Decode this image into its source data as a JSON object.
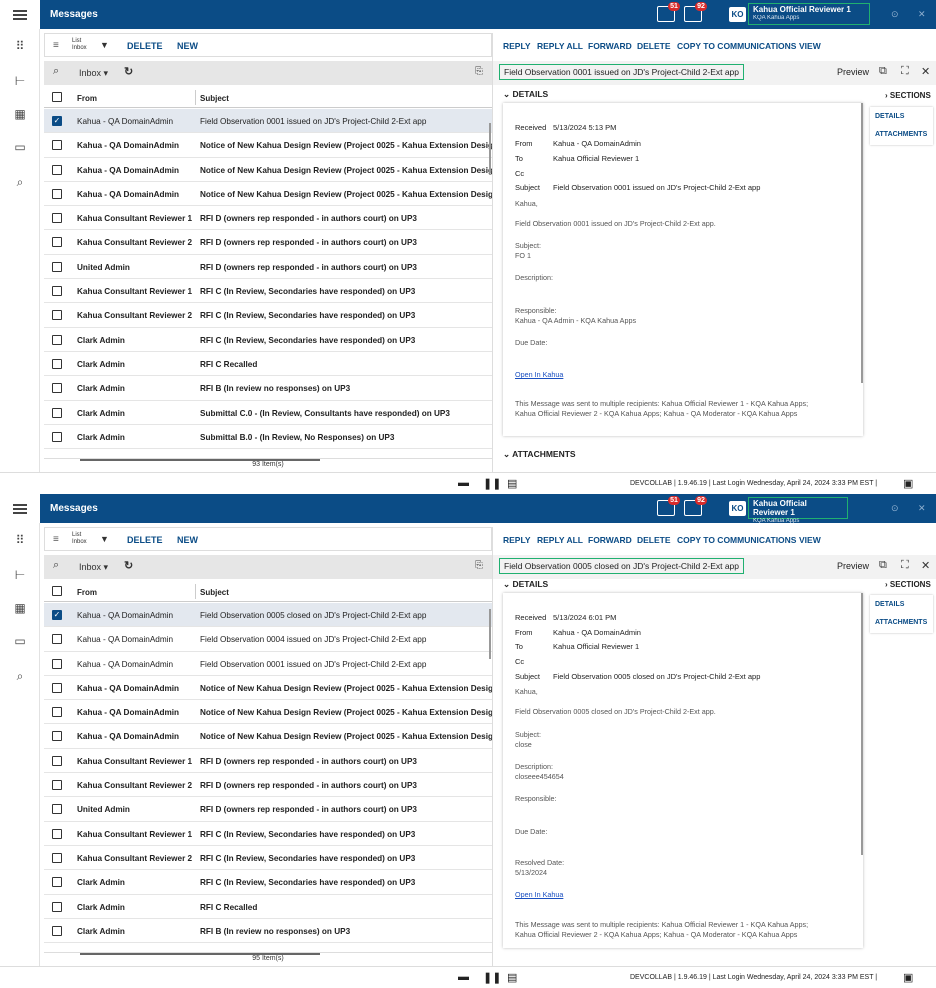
{
  "app": {
    "title": "Messages"
  },
  "header": {
    "ticket_badge": "51",
    "mail_badge": "92",
    "user_initials": "KO",
    "user_name": "Kahua Official Reviewer 1",
    "user_sub": "KQA Kahua Apps"
  },
  "list_toolbar": {
    "view_line1": "List",
    "view_line2": "Inbox",
    "delete": "DELETE",
    "new": "NEW"
  },
  "filter": {
    "folder": "Inbox"
  },
  "columns": {
    "from": "From",
    "subject": "Subject"
  },
  "reading_toolbar": {
    "reply": "REPLY",
    "reply_all": "REPLY ALL",
    "forward": "FORWARD",
    "delete": "DELETE",
    "copy": "COPY TO COMMUNICATIONS",
    "view": "VIEW"
  },
  "labels": {
    "preview": "Preview",
    "sections": "SECTIONS",
    "details": "DETAILS",
    "attachments": "ATTACHMENTS",
    "details_tab": "DETAILS",
    "attachments_tab": "ATTACHMENTS",
    "received": "Received",
    "from": "From",
    "to": "To",
    "cc": "Cc",
    "subject": "Subject",
    "subject_lbl": "Subject:",
    "description_lbl": "Description:",
    "responsible_lbl": "Responsible:",
    "due_lbl": "Due Date:",
    "resolved_lbl": "Resolved Date:",
    "open": "Open In Kahua"
  },
  "status": {
    "text": "DEVCOLLAB  |  1.9.46.19  |  Last Login Wednesday, April 24, 2024 3:33 PM EST  |"
  },
  "p1": {
    "count": "93 Item(s)",
    "rows": [
      {
        "from": "Kahua - QA DomainAdmin",
        "subject": "Field Observation  0001 issued on JD's Project-Child 2-Ext app"
      },
      {
        "from": "Kahua - QA DomainAdmin",
        "subject": "Notice of New Kahua Design Review (Project 0025 - Kahua Extension Design)"
      },
      {
        "from": "Kahua - QA DomainAdmin",
        "subject": "Notice of New Kahua Design Review (Project 0025 - Kahua Extension Design)"
      },
      {
        "from": "Kahua - QA DomainAdmin",
        "subject": "Notice of New Kahua Design Review (Project 0025 - Kahua Extension Design)"
      },
      {
        "from": "Kahua Consultant Reviewer 1",
        "subject": "RFI D (owners rep responded - in authors court) on UP3"
      },
      {
        "from": "Kahua Consultant Reviewer 2",
        "subject": "RFI D (owners rep responded - in authors court) on UP3"
      },
      {
        "from": "United Admin",
        "subject": "RFI D (owners rep responded - in authors court) on UP3"
      },
      {
        "from": "Kahua Consultant Reviewer 1",
        "subject": "RFI C (In Review, Secondaries have responded) on UP3"
      },
      {
        "from": "Kahua Consultant Reviewer 2",
        "subject": "RFI C (In Review, Secondaries have responded) on UP3"
      },
      {
        "from": "Clark Admin",
        "subject": "RFI C (In Review, Secondaries have responded) on UP3"
      },
      {
        "from": "Clark Admin",
        "subject": "RFI C Recalled"
      },
      {
        "from": "Clark Admin",
        "subject": "RFI B (In review no responses) on UP3"
      },
      {
        "from": "Clark Admin",
        "subject": "Submittal C.0 - (In Review, Consultants have responded) on UP3"
      },
      {
        "from": "Clark Admin",
        "subject": "Submittal B.0 - (In Review, No Responses) on UP3"
      }
    ],
    "msg": {
      "subject": "Field Observation  0001 issued on JD's Project-Child 2-Ext app",
      "received": "5/13/2024 5:13 PM",
      "from": "Kahua - QA DomainAdmin",
      "to": "Kahua Official Reviewer 1",
      "greeting": "Kahua,",
      "intro": "Field Observation 0001 issued on JD's Project-Child 2-Ext app.",
      "subject_val": "FO 1",
      "responsible_val": "Kahua - QA Admin - KQA Kahua Apps",
      "recip1": "This Message was sent to multiple recipients: Kahua Official Reviewer 1 - KQA Kahua Apps;",
      "recip2": "Kahua Official Reviewer 2 - KQA Kahua Apps; Kahua - QA Moderator - KQA Kahua Apps"
    }
  },
  "p2": {
    "count": "95 Item(s)",
    "rows": [
      {
        "from": "Kahua - QA DomainAdmin",
        "subject": "Field Observation  0005 closed on JD's Project-Child 2-Ext app"
      },
      {
        "from": "Kahua - QA DomainAdmin",
        "subject": "Field Observation  0004 issued on JD's Project-Child 2-Ext app"
      },
      {
        "from": "Kahua - QA DomainAdmin",
        "subject": "Field Observation  0001 issued on JD's Project-Child 2-Ext app"
      },
      {
        "from": "Kahua - QA DomainAdmin",
        "subject": "Notice of New Kahua Design Review (Project 0025 - Kahua Extension Design)"
      },
      {
        "from": "Kahua - QA DomainAdmin",
        "subject": "Notice of New Kahua Design Review (Project 0025 - Kahua Extension Design)"
      },
      {
        "from": "Kahua - QA DomainAdmin",
        "subject": "Notice of New Kahua Design Review (Project 0025 - Kahua Extension Design)"
      },
      {
        "from": "Kahua Consultant Reviewer 1",
        "subject": "RFI D (owners rep responded - in authors court) on UP3"
      },
      {
        "from": "Kahua Consultant Reviewer 2",
        "subject": "RFI D (owners rep responded - in authors court) on UP3"
      },
      {
        "from": "United Admin",
        "subject": "RFI D (owners rep responded - in authors court) on UP3"
      },
      {
        "from": "Kahua Consultant Reviewer 1",
        "subject": "RFI C (In Review, Secondaries have responded) on UP3"
      },
      {
        "from": "Kahua Consultant Reviewer 2",
        "subject": "RFI C (In Review, Secondaries have responded) on UP3"
      },
      {
        "from": "Clark Admin",
        "subject": "RFI C (In Review, Secondaries have responded) on UP3"
      },
      {
        "from": "Clark Admin",
        "subject": "RFI C Recalled"
      },
      {
        "from": "Clark Admin",
        "subject": "RFI B (In review no responses) on UP3"
      }
    ],
    "msg": {
      "subject": "Field Observation  0005 closed on JD's Project-Child 2-Ext app",
      "received": "5/13/2024 6:01 PM",
      "from": "Kahua - QA DomainAdmin",
      "to": "Kahua Official Reviewer 1",
      "greeting": "Kahua,",
      "intro": "Field Observation 0005 closed on JD's Project-Child 2-Ext app.",
      "subject_val": "close",
      "description_val": "closeee454654",
      "resolved_val": "5/13/2024",
      "recip1": "This Message was sent to multiple recipients: Kahua Official Reviewer 1 - KQA Kahua Apps;",
      "recip2": "Kahua Official Reviewer 2 - KQA Kahua Apps; Kahua - QA Moderator - KQA Kahua Apps"
    }
  }
}
